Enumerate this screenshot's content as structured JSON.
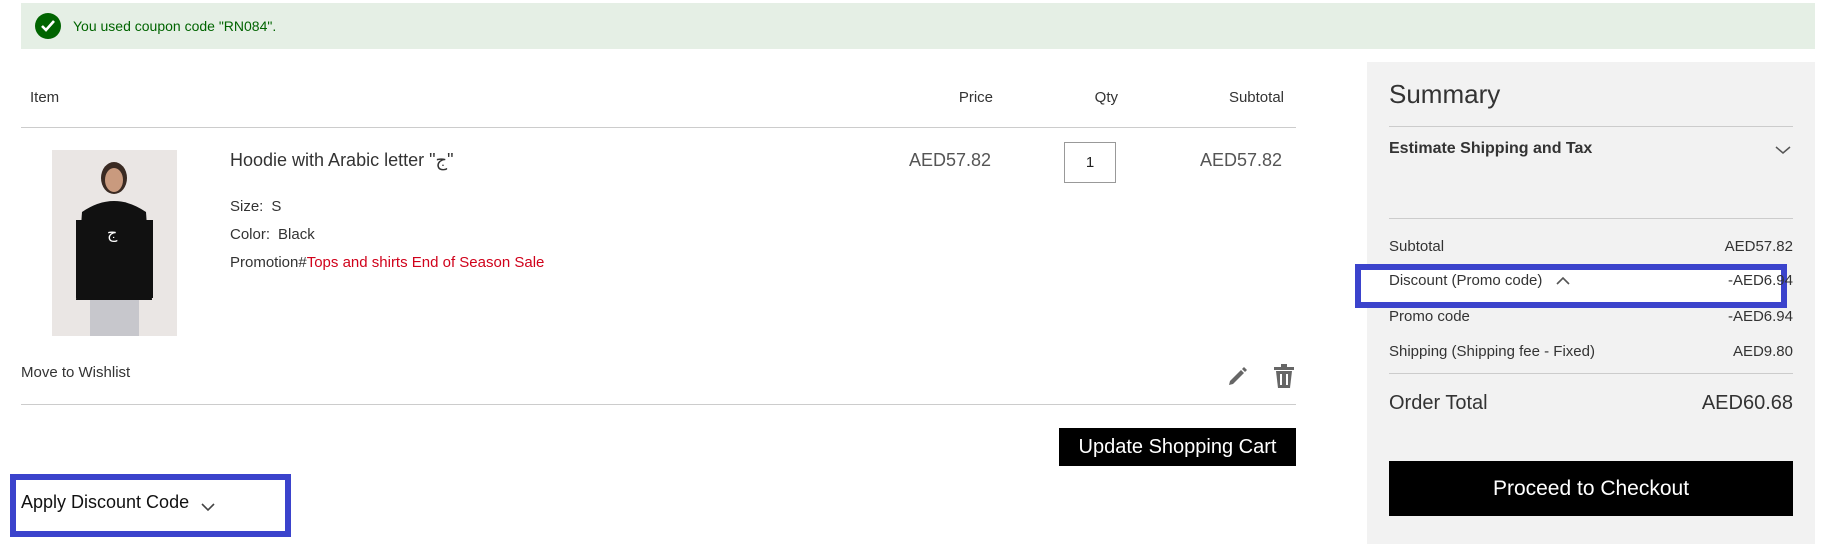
{
  "notice": {
    "message": "You used coupon code \"RN084\"."
  },
  "cart_header": {
    "item": "Item",
    "price": "Price",
    "qty": "Qty",
    "subtotal": "Subtotal"
  },
  "product": {
    "name": "Hoodie with Arabic letter \"ج\"",
    "size_label": "Size:",
    "size": "S",
    "color_label": "Color:",
    "color": "Black",
    "promotion_label": "Promotion#",
    "promotion": "Tops and shirts End of Season Sale",
    "price": "AED57.82",
    "qty": "1",
    "subtotal": "AED57.82",
    "image_letter": "ج"
  },
  "actions": {
    "wishlist": "Move to Wishlist",
    "update_cart": "Update Shopping Cart",
    "apply_discount": "Apply Discount Code"
  },
  "summary": {
    "title": "Summary",
    "estimate": "Estimate Shipping and Tax",
    "subtotal_label": "Subtotal",
    "subtotal": "AED57.82",
    "discount_label": "Discount (Promo code)",
    "discount": "-AED6.94",
    "promo_label": "Promo code",
    "promo": "-AED6.94",
    "shipping_label": "Shipping (Shipping fee - Fixed)",
    "shipping": "AED9.80",
    "total_label": "Order Total",
    "total": "AED60.68",
    "checkout": "Proceed to Checkout"
  },
  "colors": {
    "success": "#006400",
    "success_bg": "#e5efe5",
    "promo_red": "#d0021b",
    "highlight": "#3b43cc"
  }
}
